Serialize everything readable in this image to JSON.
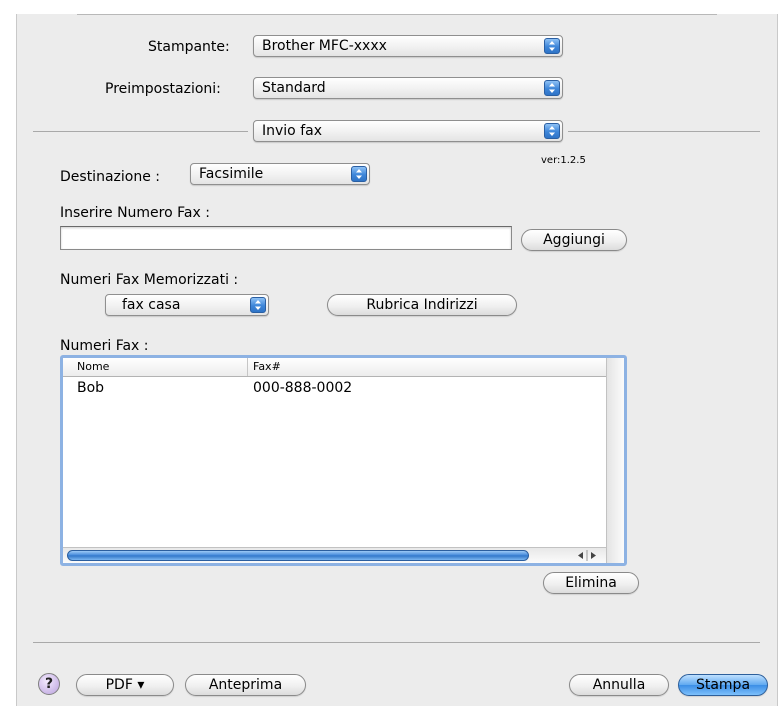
{
  "printer": {
    "label": "Stampante:",
    "value": "Brother MFC-xxxx"
  },
  "presets": {
    "label": "Preimpostazioni:",
    "value": "Standard"
  },
  "panel": {
    "value": "Invio fax"
  },
  "version": "ver:1.2.5",
  "destination": {
    "label": "Destinazione :",
    "value": "Facsimile"
  },
  "fax_number": {
    "label": "Inserire Numero Fax :",
    "value": "",
    "add_button": "Aggiungi"
  },
  "stored": {
    "label": "Numeri Fax Memorizzati :",
    "value": "fax casa",
    "address_book_button": "Rubrica Indirizzi"
  },
  "fax_list": {
    "label": "Numeri Fax :",
    "columns": [
      "Nome",
      "Fax#"
    ],
    "rows": [
      {
        "name": "Bob",
        "fax": "000-888-0002"
      }
    ],
    "delete_button": "Elimina"
  },
  "footer": {
    "help": "?",
    "pdf_button": "PDF ▾",
    "preview_button": "Anteprima",
    "cancel_button": "Annulla",
    "print_button": "Stampa"
  },
  "colors": {
    "accent": "#3c8ee6",
    "dialog_bg": "#ececec",
    "selection_border": "#8db2e3"
  }
}
